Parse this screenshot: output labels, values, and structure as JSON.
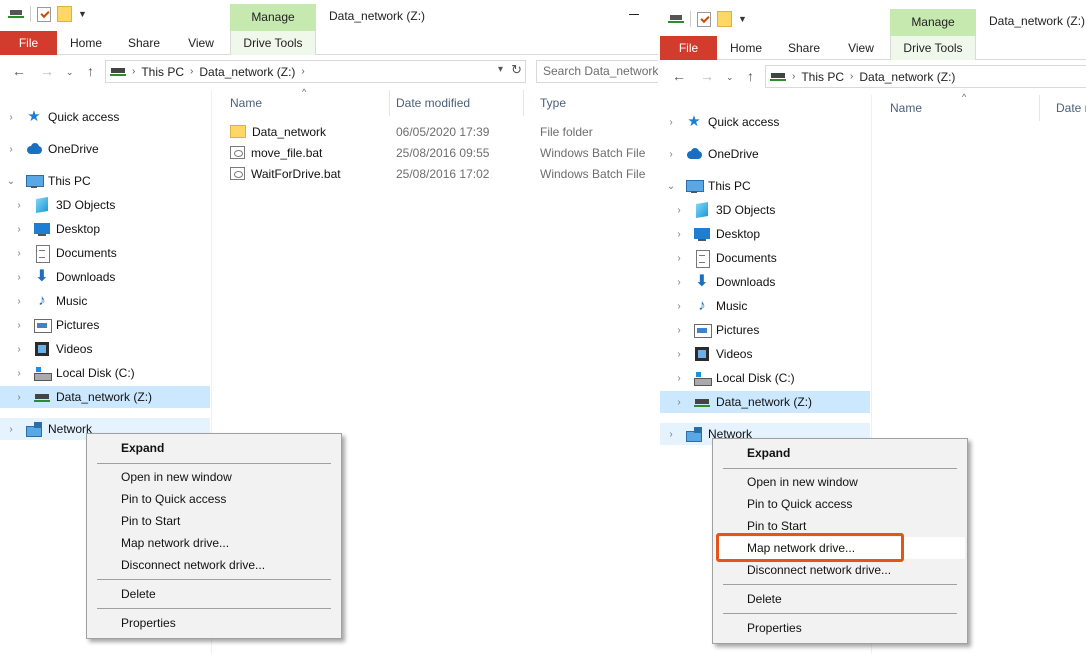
{
  "window_title": "Data_network (Z:)",
  "ribbon": {
    "manage_label": "Manage",
    "drive_tools_label": "Drive Tools",
    "tabs": [
      "File",
      "Home",
      "Share",
      "View"
    ]
  },
  "address": {
    "this_pc": "This PC",
    "current": "Data_network (Z:)"
  },
  "search": {
    "placeholder": "Search Data_network (Z:)"
  },
  "nav": {
    "quick_access": "Quick access",
    "onedrive": "OneDrive",
    "this_pc": "This PC",
    "objects_3d": "3D Objects",
    "desktop": "Desktop",
    "documents": "Documents",
    "downloads": "Downloads",
    "music": "Music",
    "pictures": "Pictures",
    "videos": "Videos",
    "local_disk": "Local Disk (C:)",
    "data_network": "Data_network (Z:)",
    "network": "Network"
  },
  "columns": {
    "name": "Name",
    "date_modified": "Date modified",
    "type": "Type",
    "date_truncated": "Date m"
  },
  "files": [
    {
      "name": "Data_network",
      "date": "06/05/2020 17:39",
      "type": "File folder",
      "icon": "folder-icon"
    },
    {
      "name": "move_file.bat",
      "date": "25/08/2016 09:55",
      "type": "Windows Batch File",
      "icon": "batch-file-icon"
    },
    {
      "name": "WaitForDrive.bat",
      "date": "25/08/2016 17:02",
      "type": "Windows Batch File",
      "icon": "batch-file-icon"
    }
  ],
  "context_menu": {
    "expand": "Expand",
    "open_new_window": "Open in new window",
    "pin_quick_access": "Pin to Quick access",
    "pin_start": "Pin to Start",
    "map_network_drive": "Map network drive...",
    "disconnect_network_drive": "Disconnect network drive...",
    "delete": "Delete",
    "properties": "Properties"
  },
  "colors": {
    "file_tab": "#d13c2c",
    "manage_tab": "#c6e9b0",
    "selection": "#cce8ff",
    "highlight_box": "#e8521b"
  }
}
